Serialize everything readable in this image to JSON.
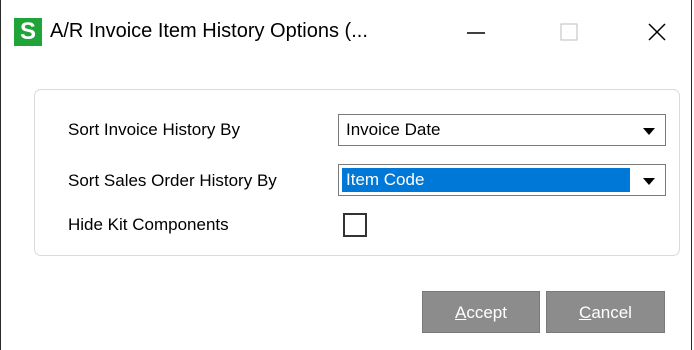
{
  "window": {
    "title": "A/R Invoice Item History Options (...",
    "app_icon_letter": "S"
  },
  "form": {
    "sort_invoice_label": "Sort Invoice History By",
    "sort_invoice_value": "Invoice Date",
    "sort_sales_order_label": "Sort Sales Order History By",
    "sort_sales_order_value": "Item Code",
    "hide_kit_label": "Hide Kit Components",
    "hide_kit_checked": false
  },
  "buttons": {
    "accept_mnemonic": "A",
    "accept_rest": "ccept",
    "cancel_mnemonic": "C",
    "cancel_rest": "ancel"
  },
  "colors": {
    "app_icon": "#1fa43a",
    "selection": "#0078d7",
    "button_bg": "#8c8c8c"
  }
}
